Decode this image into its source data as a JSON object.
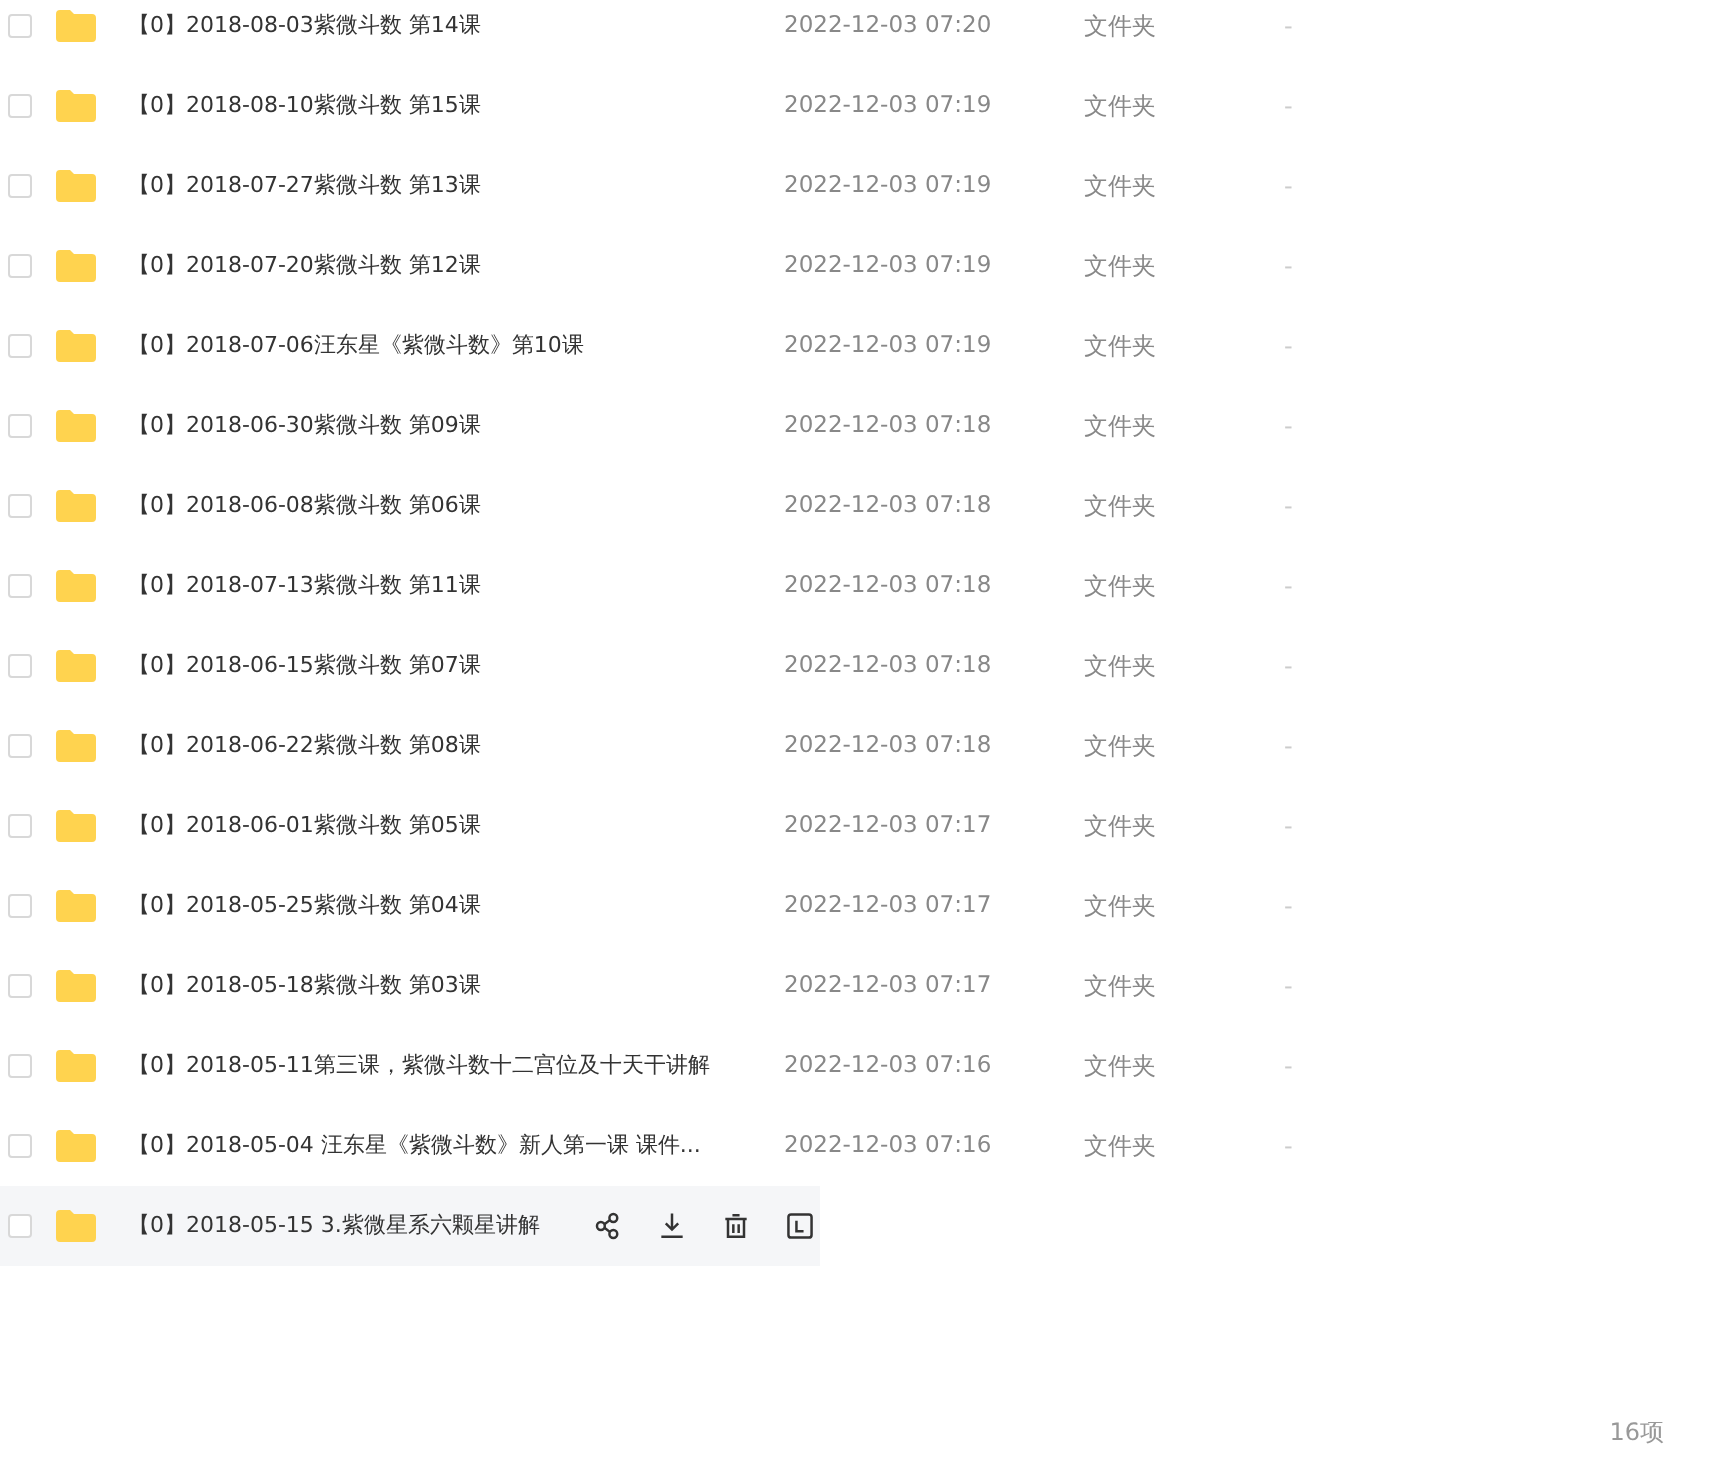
{
  "files": [
    {
      "name": "【0】2018-08-03紫微斗数 第14课",
      "modified": "2022-12-03 07:20",
      "type": "文件夹",
      "size": "-",
      "checked": false,
      "hovered": false
    },
    {
      "name": "【0】2018-08-10紫微斗数 第15课",
      "modified": "2022-12-03 07:19",
      "type": "文件夹",
      "size": "-",
      "checked": false,
      "hovered": false
    },
    {
      "name": "【0】2018-07-27紫微斗数 第13课",
      "modified": "2022-12-03 07:19",
      "type": "文件夹",
      "size": "-",
      "checked": false,
      "hovered": false
    },
    {
      "name": "【0】2018-07-20紫微斗数 第12课",
      "modified": "2022-12-03 07:19",
      "type": "文件夹",
      "size": "-",
      "checked": false,
      "hovered": false
    },
    {
      "name": "【0】2018-07-06汪东星《紫微斗数》第10课",
      "modified": "2022-12-03 07:19",
      "type": "文件夹",
      "size": "-",
      "checked": false,
      "hovered": false
    },
    {
      "name": "【0】2018-06-30紫微斗数 第09课",
      "modified": "2022-12-03 07:18",
      "type": "文件夹",
      "size": "-",
      "checked": false,
      "hovered": false
    },
    {
      "name": "【0】2018-06-08紫微斗数 第06课",
      "modified": "2022-12-03 07:18",
      "type": "文件夹",
      "size": "-",
      "checked": false,
      "hovered": false
    },
    {
      "name": "【0】2018-07-13紫微斗数 第11课",
      "modified": "2022-12-03 07:18",
      "type": "文件夹",
      "size": "-",
      "checked": false,
      "hovered": false
    },
    {
      "name": "【0】2018-06-15紫微斗数 第07课",
      "modified": "2022-12-03 07:18",
      "type": "文件夹",
      "size": "-",
      "checked": false,
      "hovered": false
    },
    {
      "name": "【0】2018-06-22紫微斗数 第08课",
      "modified": "2022-12-03 07:18",
      "type": "文件夹",
      "size": "-",
      "checked": false,
      "hovered": false
    },
    {
      "name": "【0】2018-06-01紫微斗数 第05课",
      "modified": "2022-12-03 07:17",
      "type": "文件夹",
      "size": "-",
      "checked": false,
      "hovered": false
    },
    {
      "name": "【0】2018-05-25紫微斗数 第04课",
      "modified": "2022-12-03 07:17",
      "type": "文件夹",
      "size": "-",
      "checked": false,
      "hovered": false
    },
    {
      "name": "【0】2018-05-18紫微斗数 第03课",
      "modified": "2022-12-03 07:17",
      "type": "文件夹",
      "size": "-",
      "checked": false,
      "hovered": false
    },
    {
      "name": "【0】2018-05-11第三课，紫微斗数十二宫位及十天干讲解",
      "modified": "2022-12-03 07:16",
      "type": "文件夹",
      "size": "-",
      "checked": false,
      "hovered": false
    },
    {
      "name": "【0】2018-05-04 汪东星《紫微斗数》新人第一课 课件...",
      "modified": "2022-12-03 07:16",
      "type": "文件夹",
      "size": "-",
      "checked": false,
      "hovered": false
    },
    {
      "name": "【0】2018-05-15 3.紫微星系六颗星讲解",
      "checked": false,
      "hovered": true
    }
  ],
  "item_count": "16项"
}
